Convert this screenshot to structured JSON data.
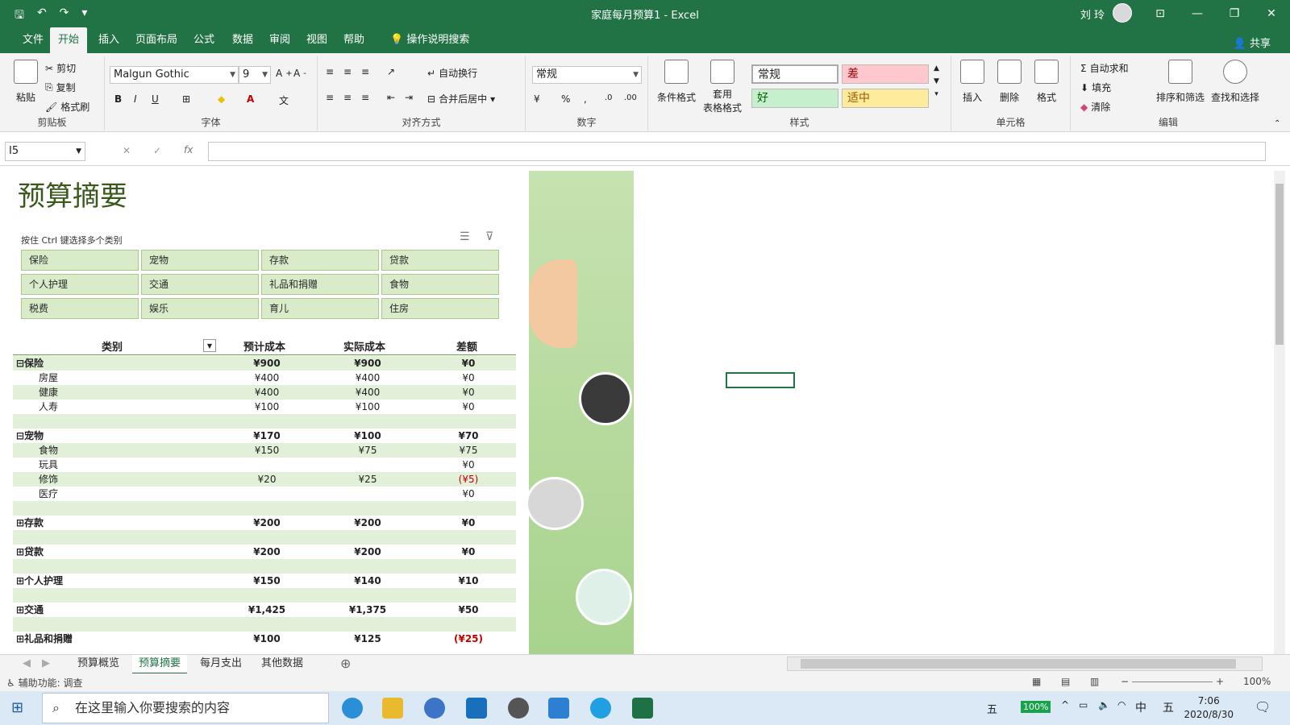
{
  "titlebar": {
    "title": "家庭每月预算1  -  Excel",
    "user": "刘 玲",
    "qat_icons": [
      "save-icon",
      "undo-icon",
      "redo-icon",
      "customize-icon"
    ]
  },
  "menu": {
    "tabs": [
      "文件",
      "开始",
      "插入",
      "页面布局",
      "公式",
      "数据",
      "审阅",
      "视图",
      "帮助"
    ],
    "active": "开始",
    "tellme": "操作说明搜索",
    "share": "共享"
  },
  "ribbon": {
    "clipboard": {
      "paste": "粘贴",
      "cut": "剪切",
      "copy": "复制",
      "format_painter": "格式刷",
      "label": "剪贴板"
    },
    "font": {
      "name": "Malgun Gothic",
      "size": "9",
      "bold": "B",
      "italic": "I",
      "underline": "U",
      "label": "字体"
    },
    "alignment": {
      "wrap": "自动换行",
      "merge": "合并后居中",
      "label": "对齐方式"
    },
    "number": {
      "format": "常规",
      "label": "数字"
    },
    "styles": {
      "conditional": "条件格式",
      "table_line1": "套用",
      "table_line2": "表格格式",
      "normal": "常规",
      "bad": "差",
      "good": "好",
      "neutral": "适中",
      "label": "样式"
    },
    "cells": {
      "insert": "插入",
      "delete": "删除",
      "format": "格式",
      "label": "单元格"
    },
    "editing": {
      "autosum": "自动求和",
      "fill": "填充",
      "clear": "清除",
      "sort": "排序和筛选",
      "find": "查找和选择",
      "label": "编辑"
    }
  },
  "formula_bar": {
    "namebox": "I5",
    "fx": "fx",
    "formula": ""
  },
  "sheet": {
    "title": "预算摘要",
    "hint": "按住 Ctrl 键选择多个类别",
    "slicer": [
      "保险",
      "宠物",
      "存款",
      "贷款",
      "个人护理",
      "交通",
      "礼品和捐赠",
      "食物",
      "税费",
      "娱乐",
      "育儿",
      "住房"
    ],
    "headers": [
      "类别",
      "预计成本",
      "实际成本",
      "差额"
    ],
    "rows": [
      {
        "cat": "⊟保险",
        "est": "¥900",
        "act": "¥900",
        "diff": "¥0",
        "bold": true,
        "band": true
      },
      {
        "cat": "房屋",
        "est": "¥400",
        "act": "¥400",
        "diff": "¥0"
      },
      {
        "cat": "健康",
        "est": "¥400",
        "act": "¥400",
        "diff": "¥0",
        "band": true
      },
      {
        "cat": "人寿",
        "est": "¥100",
        "act": "¥100",
        "diff": "¥0"
      },
      {
        "cat": "",
        "est": "",
        "act": "",
        "diff": "",
        "band": true
      },
      {
        "cat": "⊟宠物",
        "est": "¥170",
        "act": "¥100",
        "diff": "¥70",
        "bold": true
      },
      {
        "cat": "食物",
        "est": "¥150",
        "act": "¥75",
        "diff": "¥75",
        "band": true
      },
      {
        "cat": "玩具",
        "est": "",
        "act": "",
        "diff": "¥0"
      },
      {
        "cat": "修饰",
        "est": "¥20",
        "act": "¥25",
        "diff": "(¥5)",
        "band": true,
        "neg": true
      },
      {
        "cat": "医疗",
        "est": "",
        "act": "",
        "diff": "¥0"
      },
      {
        "cat": "",
        "est": "",
        "act": "",
        "diff": "",
        "band": true
      },
      {
        "cat": "⊞存款",
        "est": "¥200",
        "act": "¥200",
        "diff": "¥0",
        "bold": true
      },
      {
        "cat": "",
        "est": "",
        "act": "",
        "diff": "",
        "band": true
      },
      {
        "cat": "⊞贷款",
        "est": "¥200",
        "act": "¥200",
        "diff": "¥0",
        "bold": true
      },
      {
        "cat": "",
        "est": "",
        "act": "",
        "diff": "",
        "band": true
      },
      {
        "cat": "⊞个人护理",
        "est": "¥150",
        "act": "¥140",
        "diff": "¥10",
        "bold": true
      },
      {
        "cat": "",
        "est": "",
        "act": "",
        "diff": "",
        "band": true
      },
      {
        "cat": "⊞交通",
        "est": "¥1,425",
        "act": "¥1,375",
        "diff": "¥50",
        "bold": true
      },
      {
        "cat": "",
        "est": "",
        "act": "",
        "diff": "",
        "band": true
      },
      {
        "cat": "⊞礼品和捐赠",
        "est": "¥100",
        "act": "¥125",
        "diff": "(¥25)",
        "bold": true,
        "neg": true
      }
    ]
  },
  "sheet_tabs": [
    "预算概览",
    "预算摘要",
    "每月支出",
    "其他数据"
  ],
  "active_sheet": "预算摘要",
  "statusbar": {
    "accessibility": "辅助功能: 调查",
    "zoom": "100%"
  },
  "taskbar": {
    "search": "在这里输入你要搜索的内容",
    "ime": "五",
    "battery": "100%",
    "lang": "中",
    "time": "7:06",
    "date": "2020/8/30"
  },
  "colors": {
    "excel_green": "#217346",
    "slicer_bg": "#d9ebc8",
    "band": "#e2efd9",
    "negative": "#c00000"
  }
}
